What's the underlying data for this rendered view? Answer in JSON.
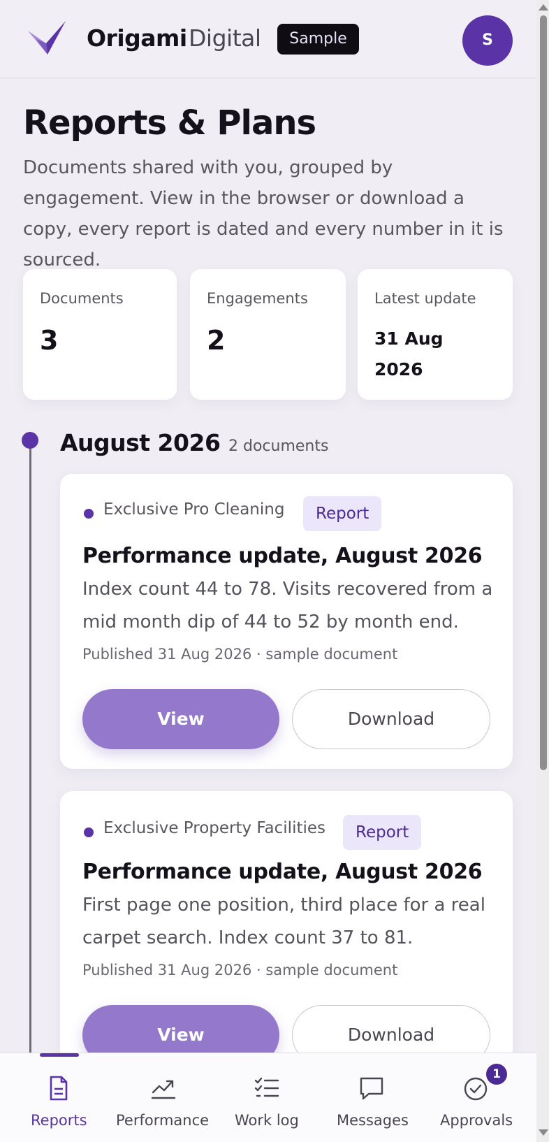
{
  "header": {
    "brand_name": "Origami",
    "brand_sub": "Digital",
    "sample_badge": "Sample",
    "avatar_initial": "S"
  },
  "page": {
    "title": "Reports & Plans",
    "description": "Documents shared with you, grouped by engagement. View in the browser or download a copy, every report is dated and every number in it is sourced."
  },
  "stats": [
    {
      "label": "Documents",
      "value": "3"
    },
    {
      "label": "Engagements",
      "value": "2"
    },
    {
      "label": "Latest update",
      "value": "31 Aug 2026"
    }
  ],
  "group": {
    "title": "August 2026",
    "count": "2 documents"
  },
  "cards": [
    {
      "client": "Exclusive Pro Cleaning",
      "tag": "Report",
      "title": "Performance update, August 2026",
      "summary": "Index count 44 to 78. Visits recovered from a mid month dip of 44 to 52 by month end.",
      "meta": "Published 31 Aug 2026 · sample document",
      "view_label": "View",
      "download_label": "Download"
    },
    {
      "client": "Exclusive Property Facilities",
      "tag": "Report",
      "title": "Performance update, August 2026",
      "summary": "First page one position, third place for a real carpet search. Index count 37 to 81.",
      "meta": "Published 31 Aug 2026 · sample document",
      "view_label": "View",
      "download_label": "Download"
    }
  ],
  "nav": {
    "items": [
      {
        "label": "Reports",
        "icon": "document-icon",
        "active": true
      },
      {
        "label": "Performance",
        "icon": "trend-icon",
        "active": false
      },
      {
        "label": "Work log",
        "icon": "checklist-icon",
        "active": false
      },
      {
        "label": "Messages",
        "icon": "chat-icon",
        "active": false
      },
      {
        "label": "Approvals",
        "icon": "check-circle-icon",
        "active": false
      }
    ],
    "approvals_badge": "1"
  },
  "colors": {
    "accent": "#5a34a6",
    "button_view": "#9378cb",
    "tag_bg": "#ece6fa",
    "background": "#f0eef4"
  }
}
